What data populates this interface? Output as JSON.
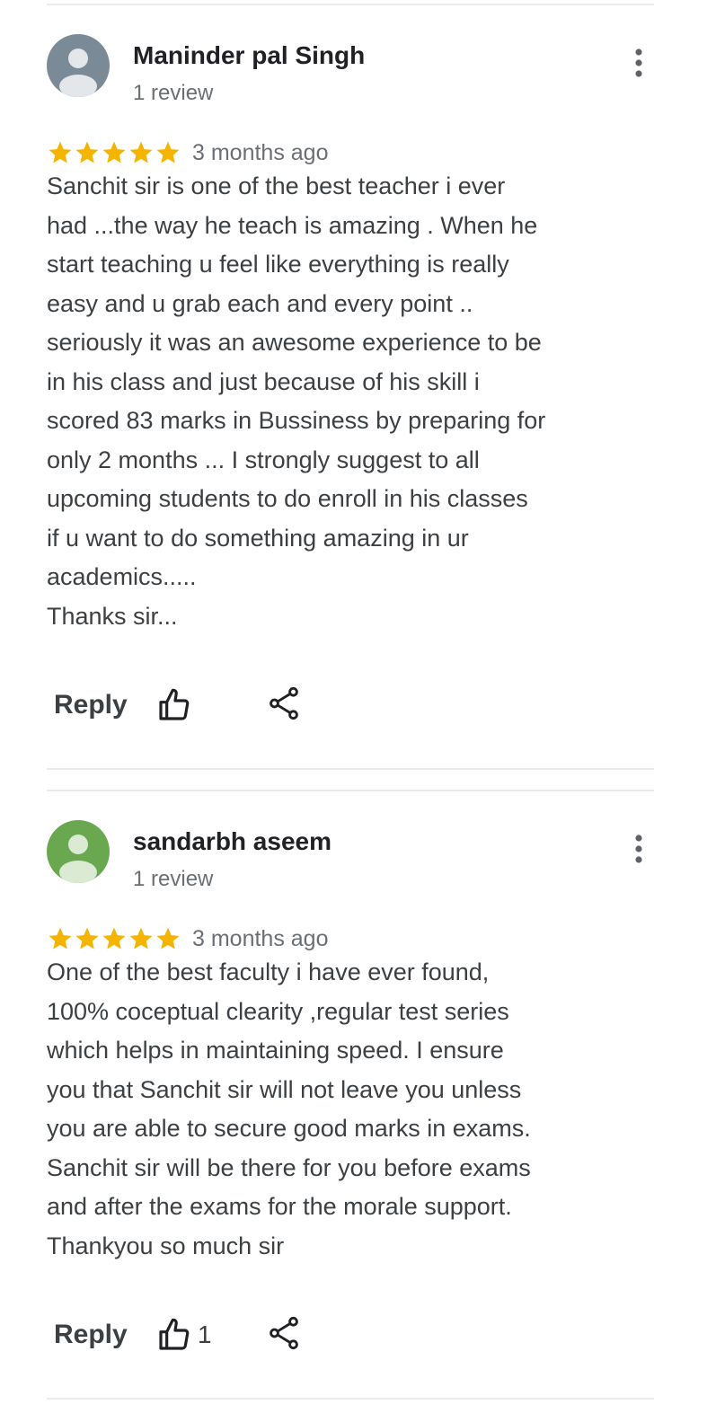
{
  "colors": {
    "star": "#f4b400",
    "avatar1": "#7a8b97",
    "avatar2": "#6aa84f",
    "divider": "#ebebeb"
  },
  "reviews": [
    {
      "name": "Maninder pal Singh",
      "review_count": "1 review",
      "rating": 5,
      "time": "3 months ago",
      "text": "Sanchit sir is one of the best teacher i ever\nhad ...the way he teach is amazing . When he\nstart teaching u feel like everything is really\neasy and u grab each and every point ..\nseriously it was an awesome experience to be\nin his class and just because of his skill i\nscored 83 marks in Bussiness by preparing for\nonly 2 months ... I strongly suggest to all\nupcoming students to do enroll in his classes\nif u want to do something amazing in ur\nacademics.....\nThanks sir...",
      "reply_label": "Reply",
      "likes": ""
    },
    {
      "name": "sandarbh aseem",
      "review_count": "1 review",
      "rating": 5,
      "time": "3 months ago",
      "text": "One of the best faculty i have ever found,\n100% coceptual clearity ,regular test series\nwhich helps in maintaining speed. I ensure\nyou that Sanchit sir will not leave you unless\nyou are able to secure good marks in exams.\nSanchit sir will be there for you before exams\nand after the exams  for the morale support.\nThankyou so much sir",
      "reply_label": "Reply",
      "likes": "1"
    }
  ]
}
